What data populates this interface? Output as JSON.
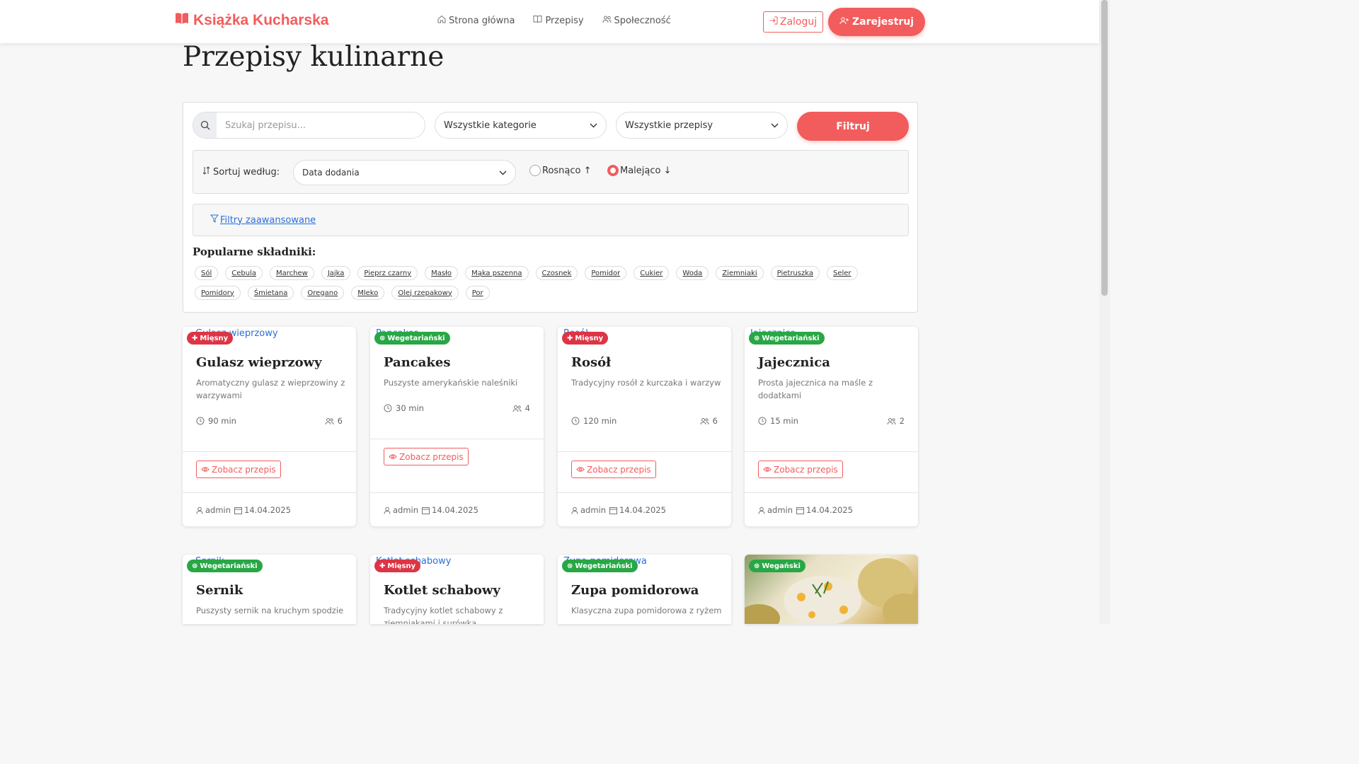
{
  "brand": {
    "name": "Książka Kucharska"
  },
  "nav": {
    "home": "Strona główna",
    "recipes": "Przepisy",
    "community": "Społeczność",
    "login": "Zaloguj",
    "register": "Zarejestruj"
  },
  "page": {
    "title": "Przepisy kulinarne"
  },
  "filters": {
    "search_placeholder": "Szukaj przepisu...",
    "category": "Wszystkie kategorie",
    "recipes": "Wszystkie przepisy",
    "filter_button": "Filtruj",
    "sort_label": "Sortuj według:",
    "sort_value": "Data dodania",
    "asc": "Rosnąco ↑",
    "desc": "Malejąco ↓",
    "advanced": "Filtry zaawansowane",
    "popular_title": "Popularne składniki:",
    "ingredients": [
      "Sól",
      "Cebula",
      "Marchew",
      "Jajka",
      "Pieprz czarny",
      "Masło",
      "Mąka pszenna",
      "Czosnek",
      "Pomidor",
      "Cukier",
      "Woda",
      "Ziemniaki",
      "Pietruszka",
      "Seler",
      "Pomidory",
      "Śmietana",
      "Oregano",
      "Mleko",
      "Olej rzepakowy",
      "Por"
    ]
  },
  "cards": [
    {
      "img_alt": "Gulasz wieprzowy",
      "badge": "Mięsny",
      "title": "Gulasz wieprzowy",
      "desc": "Aromatyczny gulasz z wieprzowiny z warzywami",
      "time": "90 min",
      "servings": "6",
      "view": "Zobacz przepis",
      "author": "admin",
      "date": "14.04.2025"
    },
    {
      "img_alt": "Pancakes",
      "badge": "Wegetariański",
      "title": "Pancakes",
      "desc": "Puszyste amerykańskie naleśniki",
      "time": "30 min",
      "servings": "4",
      "view": "Zobacz przepis",
      "author": "admin",
      "date": "14.04.2025"
    },
    {
      "img_alt": "Rosół",
      "badge": "Mięsny",
      "title": "Rosół",
      "desc": "Tradycyjny rosół z kurczaka i warzyw",
      "time": "120 min",
      "servings": "6",
      "view": "Zobacz przepis",
      "author": "admin",
      "date": "14.04.2025"
    },
    {
      "img_alt": "Jajecznica",
      "badge": "Wegetariański",
      "title": "Jajecznica",
      "desc": "Prosta jajecznica na maśle z dodatkami",
      "time": "15 min",
      "servings": "2",
      "view": "Zobacz przepis",
      "author": "admin",
      "date": "14.04.2025"
    },
    {
      "img_alt": "Sernik",
      "badge": "Wegetariański",
      "title": "Sernik",
      "desc": "Puszysty sernik na kruchym spodzie"
    },
    {
      "img_alt": "Kotlet schabowy",
      "badge": "Mięsny",
      "title": "Kotlet schabowy",
      "desc": "Tradycyjny kotlet schabowy z ziemniakami i surówką"
    },
    {
      "img_alt": "Zupa pomidorowa",
      "badge": "Wegetariański",
      "title": "Zupa pomidorowa",
      "desc": "Klasyczna zupa pomidorowa z ryżem"
    },
    {
      "badge": "Wegański"
    }
  ]
}
